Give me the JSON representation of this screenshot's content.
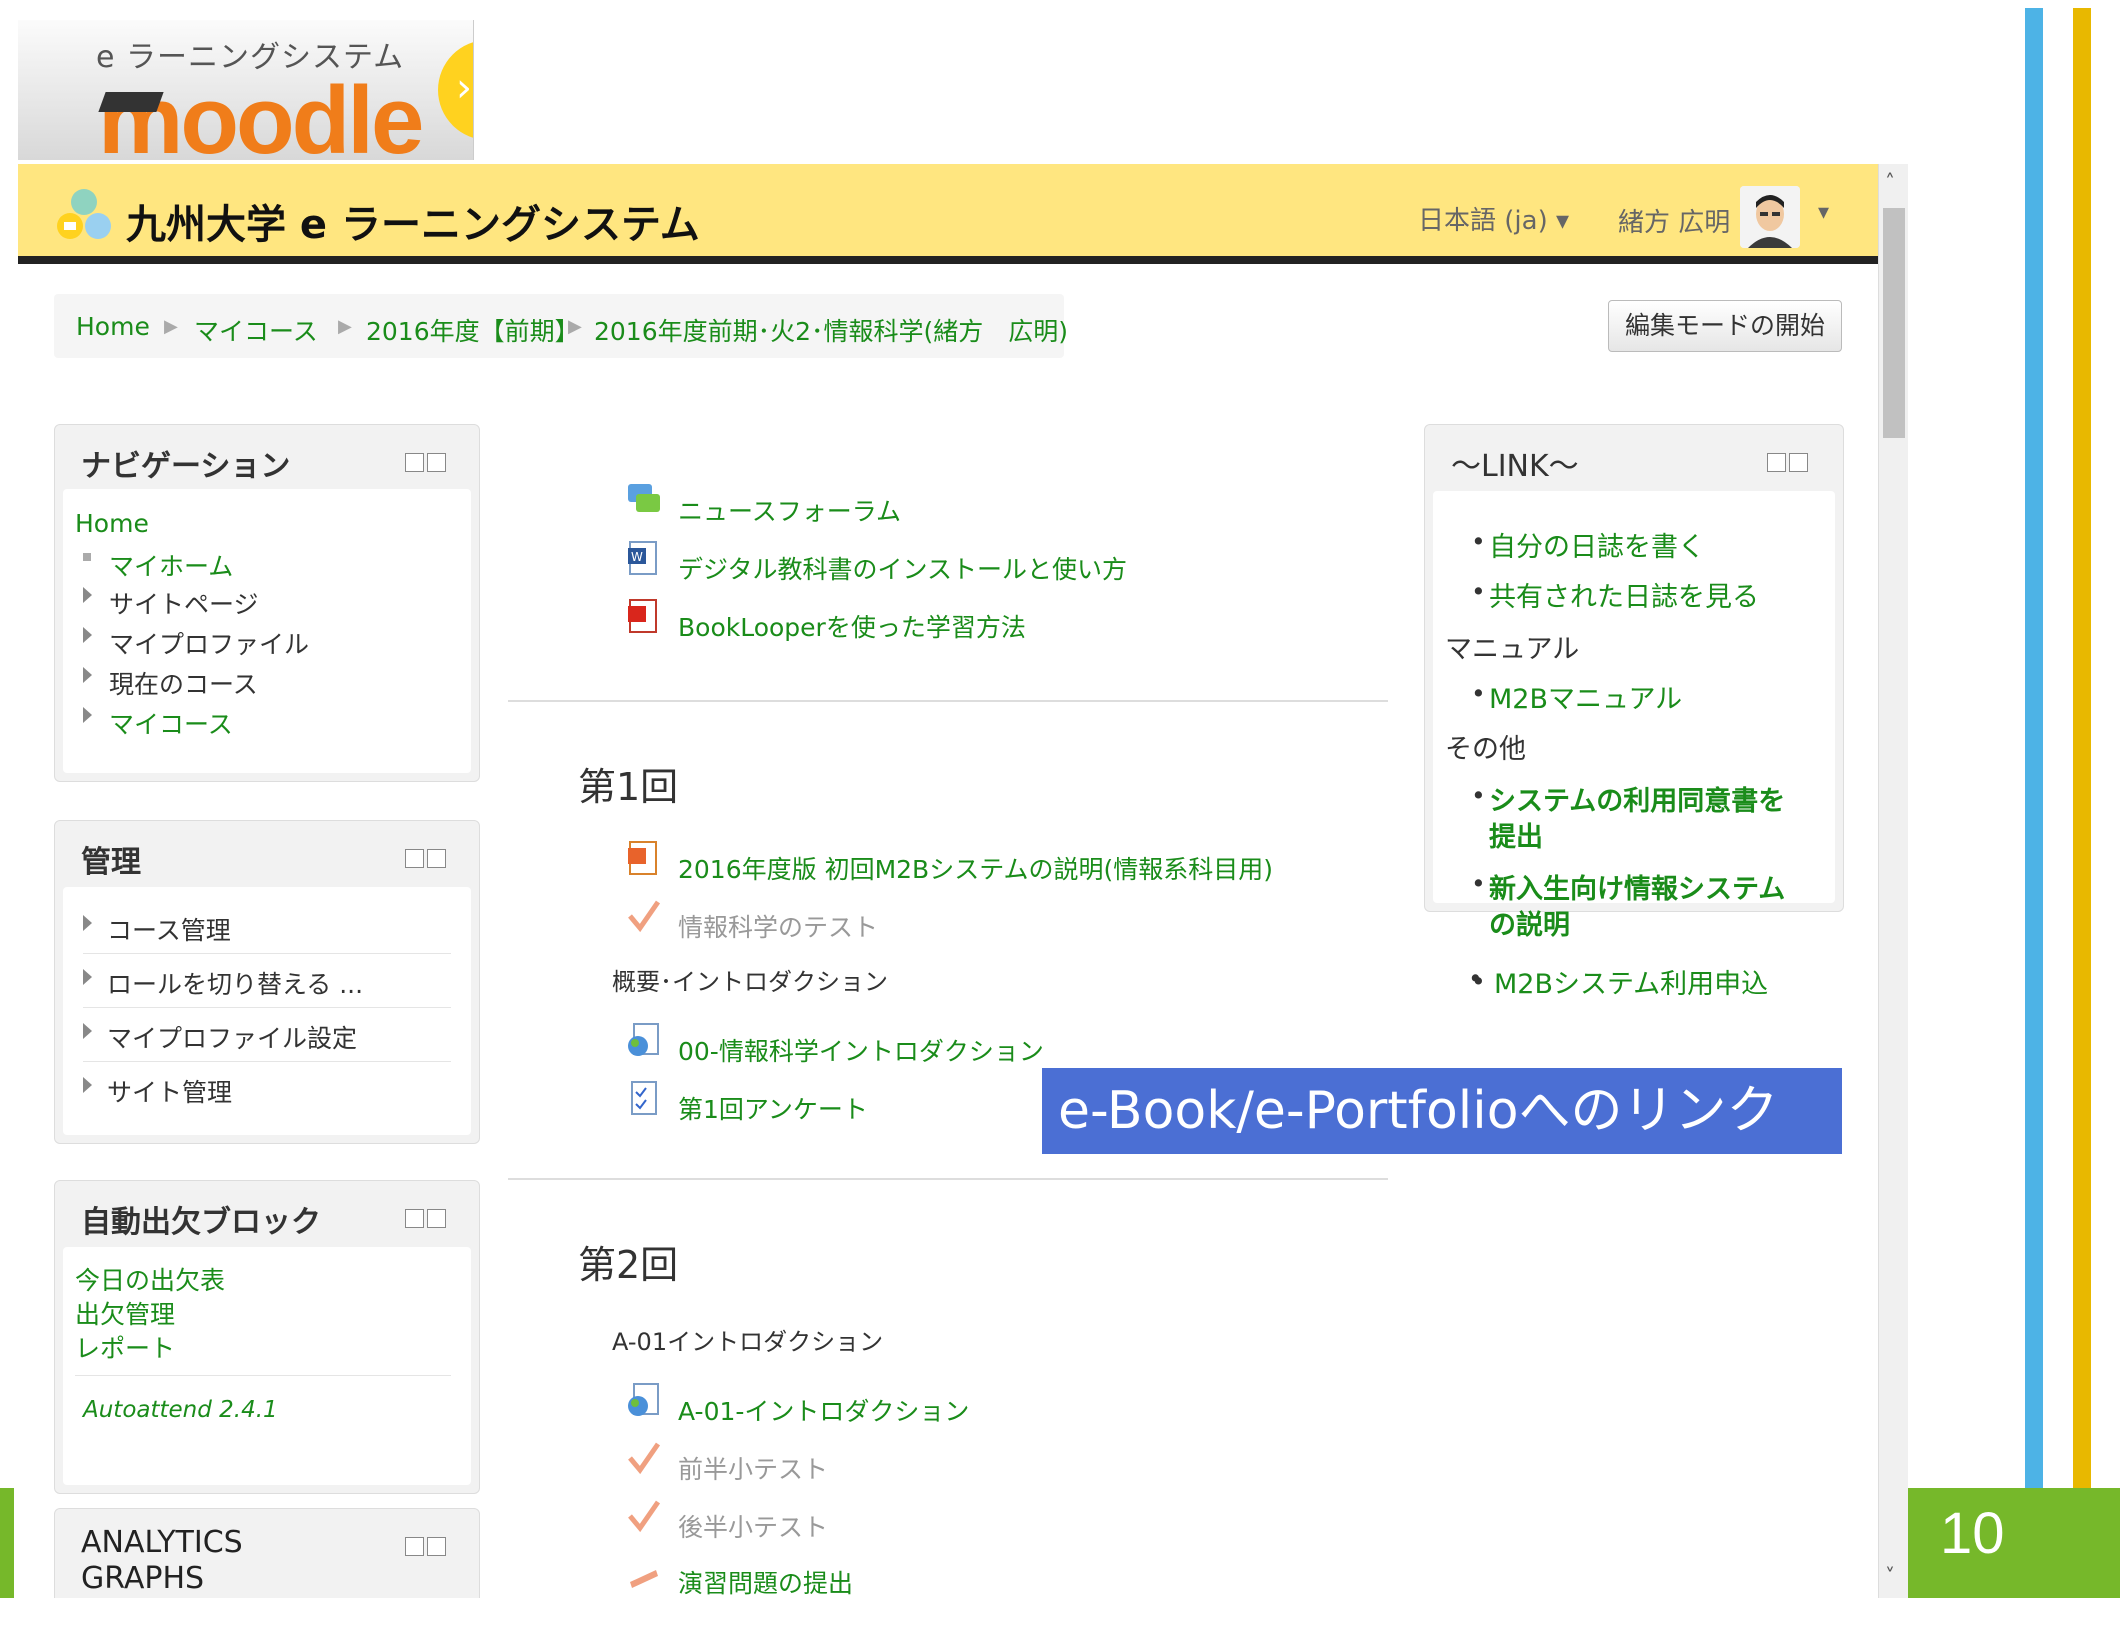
{
  "slide": {
    "page_number": "10"
  },
  "logo": {
    "subtitle": "e ラーニングシステム",
    "wordmark": "moodle"
  },
  "header": {
    "site_title": "九州大学 e ラーニングシステム",
    "language": "日本語 (ja)",
    "username": "緒方 広明"
  },
  "breadcrumb": [
    "Home",
    "マイコース",
    "2016年度【前期】",
    "2016年度前期･火2･情報科学(緒方　広明)"
  ],
  "edit_button": "編集モードの開始",
  "navigation": {
    "title": "ナビゲーション",
    "home": "Home",
    "items": [
      "マイホーム",
      "サイトページ",
      "マイプロファイル",
      "現在のコース",
      "マイコース"
    ]
  },
  "admin": {
    "title": "管理",
    "items": [
      "コース管理",
      "ロールを切り替える ...",
      "マイプロファイル設定",
      "サイト管理"
    ]
  },
  "attendance": {
    "title": "自動出欠ブロック",
    "links": [
      "今日の出欠表",
      "出欠管理",
      "レポート"
    ],
    "version": "Autoattend 2.4.1"
  },
  "analytics": {
    "title_line1": "ANALYTICS",
    "title_line2": "GRAPHS"
  },
  "top_section": {
    "activities": [
      "ニュースフォーラム",
      "デジタル教科書のインストールと使い方",
      "BookLooperを使った学習方法"
    ]
  },
  "section1": {
    "title": "第1回",
    "activities": [
      "2016年度版 初回M2Bシステムの説明(情報系科目用)",
      "情報科学のテスト"
    ],
    "label": "概要･イントロダクション",
    "activities2": [
      "00-情報科学イントロダクション",
      "第1回アンケート"
    ]
  },
  "section2": {
    "title": "第2回",
    "label": "A-01イントロダクション",
    "activities": [
      "A-01-イントロダクション",
      "前半小テスト",
      "後半小テスト",
      "演習問題の提出"
    ]
  },
  "link_block": {
    "title": "～LINK～",
    "items": [
      "自分の日誌を書く",
      "共有された日誌を見る"
    ],
    "manual_heading": "マニュアル",
    "manual_items": [
      "M2Bマニュアル"
    ],
    "other_heading": "その他",
    "other_items": [
      "システムの利用同意書を",
      "提出",
      "新入生向け情報システム",
      "の説明",
      "M2Bシステム利用申込"
    ]
  },
  "overlay": {
    "text": "e-Book/e-Portfolioへのリンク"
  }
}
